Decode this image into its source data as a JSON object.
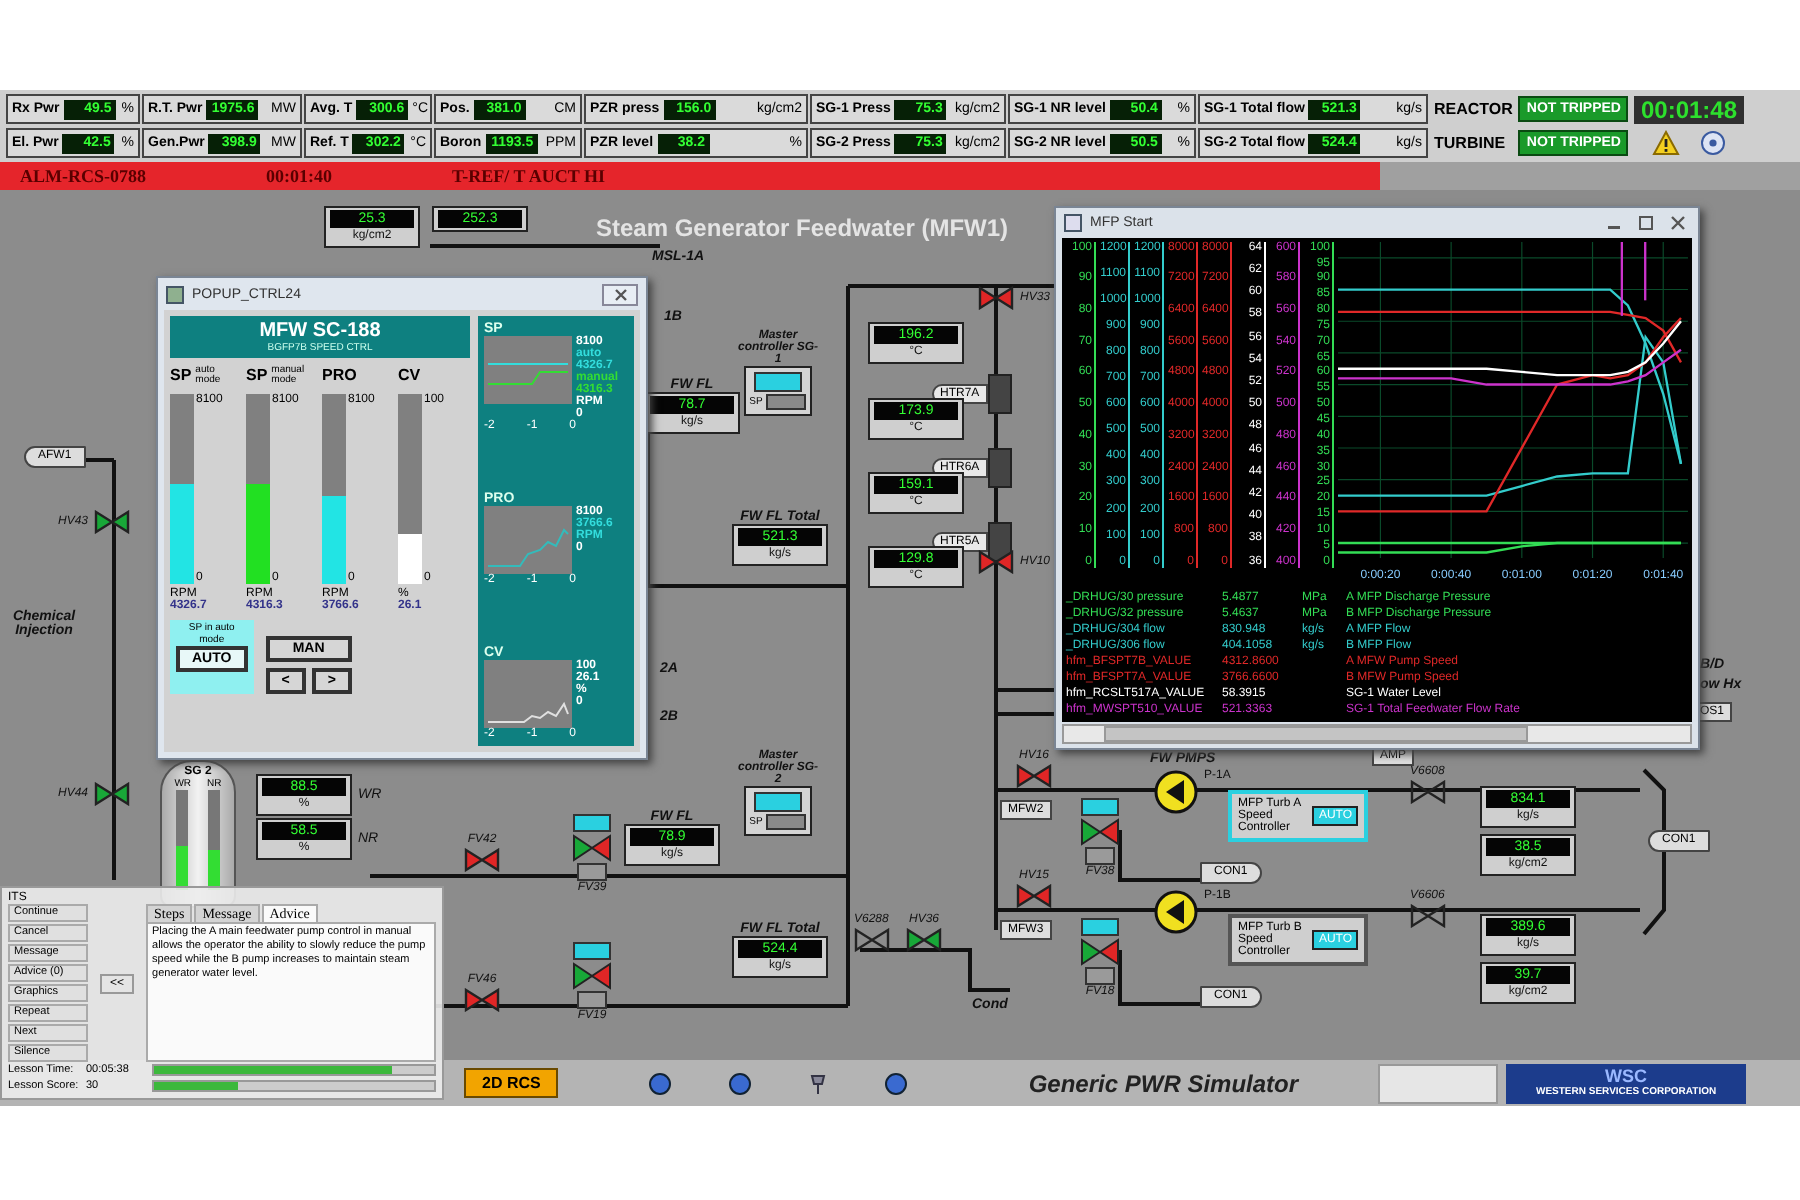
{
  "header": {
    "rows": [
      [
        {
          "label": "Rx Pwr",
          "value": "49.5",
          "unit": "%"
        },
        {
          "label": "R.T. Pwr",
          "value": "1975.6",
          "unit": "MW"
        },
        {
          "label": "Avg. T",
          "value": "300.6",
          "unit": "°C"
        },
        {
          "label": "Pos.",
          "value": "381.0",
          "unit": "CM"
        },
        {
          "label": "PZR press",
          "value": "156.0",
          "unit": "kg/cm2"
        },
        {
          "label": "SG-1 Press",
          "value": "75.3",
          "unit": "kg/cm2"
        },
        {
          "label": "SG-1 NR level",
          "value": "50.4",
          "unit": "%"
        },
        {
          "label": "SG-1 Total flow",
          "value": "521.3",
          "unit": "kg/s"
        }
      ],
      [
        {
          "label": "El. Pwr",
          "value": "42.5",
          "unit": "%"
        },
        {
          "label": "Gen.Pwr",
          "value": "398.9",
          "unit": "MW"
        },
        {
          "label": "Ref. T",
          "value": "302.2",
          "unit": "°C"
        },
        {
          "label": "Boron",
          "value": "1193.5",
          "unit": "PPM"
        },
        {
          "label": "PZR level",
          "value": "38.2",
          "unit": "%"
        },
        {
          "label": "SG-2 Press",
          "value": "75.3",
          "unit": "kg/cm2"
        },
        {
          "label": "SG-2 NR level",
          "value": "50.5",
          "unit": "%"
        },
        {
          "label": "SG-2 Total flow",
          "value": "524.4",
          "unit": "kg/s"
        }
      ]
    ],
    "status": [
      {
        "label": "REACTOR",
        "value": "NOT TRIPPED"
      },
      {
        "label": "TURBINE",
        "value": "NOT TRIPPED"
      }
    ],
    "clock": "00:01:48"
  },
  "alarm": {
    "code": "ALM-RCS-0788",
    "time": "00:01:40",
    "message": "T-REF/ T AUCT HI"
  },
  "diagram": {
    "items": [
      {
        "kind": "readout",
        "value": "25.3",
        "unit": "kg/cm2"
      },
      {
        "kind": "readout",
        "value": "252.3"
      },
      {
        "kind": "title",
        "text": "Steam Generator Feedwater (MFW1)"
      },
      {
        "kind": "label",
        "text": "MSL-1A"
      },
      {
        "kind": "label",
        "text": "1B"
      },
      {
        "kind": "label",
        "text": "2A"
      },
      {
        "kind": "label",
        "text": "2B"
      },
      {
        "kind": "arrow_tag",
        "label": "AFW1",
        "pointing_left": true
      },
      {
        "kind": "valve",
        "label": "HV43",
        "open": true
      },
      {
        "kind": "label",
        "text": "Chemical Injection"
      },
      {
        "kind": "valve",
        "label": "HV44",
        "open": true
      },
      {
        "kind": "tank",
        "label": "SG 2",
        "bars": [
          {
            "label": "WR",
            "level": 0.45
          },
          {
            "label": "NR",
            "level": 0.4
          }
        ]
      },
      {
        "kind": "readout",
        "value": "88.5",
        "unit": "%",
        "note": "WR"
      },
      {
        "kind": "readout",
        "value": "58.5",
        "unit": "%",
        "note": "NR"
      },
      {
        "kind": "readout",
        "title": "FW FL",
        "value": "78.7",
        "unit": "kg/s"
      },
      {
        "kind": "controller",
        "title": "Master controller SG-1",
        "sp_label": "SP"
      },
      {
        "kind": "readout",
        "title": "FW FL Total",
        "value": "521.3",
        "unit": "kg/s"
      },
      {
        "kind": "readout",
        "value": "196.2",
        "unit": "°C"
      },
      {
        "kind": "heater",
        "label": "HTR7A"
      },
      {
        "kind": "readout",
        "value": "173.9",
        "unit": "°C"
      },
      {
        "kind": "heater",
        "label": "HTR6A"
      },
      {
        "kind": "readout",
        "value": "159.1",
        "unit": "°C"
      },
      {
        "kind": "heater",
        "label": "HTR5A"
      },
      {
        "kind": "readout",
        "value": "129.8",
        "unit": "°C"
      },
      {
        "kind": "valve",
        "label": "HV33",
        "open": false
      },
      {
        "kind": "valve",
        "label": "HV10",
        "open": false
      },
      {
        "kind": "controller",
        "title": "Master controller SG-2",
        "sp_label": "SP"
      },
      {
        "kind": "readout",
        "title": "FW FL",
        "value": "78.9",
        "unit": "kg/s"
      },
      {
        "kind": "readout",
        "title": "FW FL Total",
        "value": "524.4",
        "unit": "kg/s"
      },
      {
        "kind": "valve",
        "label": "FV42",
        "open": false
      },
      {
        "kind": "valve",
        "label": "FV46",
        "open": false
      },
      {
        "kind": "control_valve",
        "label": "FV39"
      },
      {
        "kind": "control_valve",
        "label": "FV19"
      },
      {
        "kind": "hand_valve",
        "label": "V6288"
      },
      {
        "kind": "valve",
        "label": "HV36",
        "open": true
      },
      {
        "kind": "label",
        "text": "Cond"
      },
      {
        "kind": "valve",
        "label": "HV16",
        "open": false
      },
      {
        "kind": "tag",
        "label": "MFW2"
      },
      {
        "kind": "valve",
        "label": "HV15",
        "open": false
      },
      {
        "kind": "tag",
        "label": "MFW3"
      },
      {
        "kind": "control_valve",
        "label": "FV38"
      },
      {
        "kind": "control_valve",
        "label": "FV18"
      },
      {
        "kind": "label",
        "text": "FW PMPS"
      },
      {
        "kind": "pump",
        "label": "P-1A"
      },
      {
        "kind": "pump",
        "label": "P-1B"
      },
      {
        "kind": "speed_controller",
        "text": "MFP Turb A Speed Controller",
        "button": "AUTO",
        "highlighted": true
      },
      {
        "kind": "speed_controller",
        "text": "MFP Turb B Speed Controller",
        "button": "AUTO",
        "highlighted": false
      },
      {
        "kind": "arrow_tag",
        "label": "CON1",
        "pointing_left": false
      },
      {
        "kind": "arrow_tag",
        "label": "CON1",
        "pointing_left": false
      },
      {
        "kind": "tag",
        "label": "AMP"
      },
      {
        "kind": "hand_valve",
        "label": "V6608"
      },
      {
        "kind": "hand_valve",
        "label": "V6606"
      },
      {
        "kind": "readout",
        "value": "834.1",
        "unit": "kg/s"
      },
      {
        "kind": "readout",
        "value": "38.5",
        "unit": "kg/cm2"
      },
      {
        "kind": "readout",
        "value": "389.6",
        "unit": "kg/s"
      },
      {
        "kind": "readout",
        "value": "39.7",
        "unit": "kg/cm2"
      },
      {
        "kind": "arrow_tag",
        "label": "CON1",
        "pointing_left": true
      },
      {
        "kind": "label",
        "text": "B/D"
      },
      {
        "kind": "label",
        "text": "ow Hx"
      },
      {
        "kind": "tag",
        "label": "OS1"
      }
    ]
  },
  "popup": {
    "title": "POPUP_CTRL24",
    "heading": "MFW SC-188",
    "subheading": "BGFP7B SPEED CTRL",
    "gauges": [
      {
        "label": "SP",
        "mode": "auto mode",
        "max": "8100",
        "min": "0",
        "unit": "RPM",
        "reading": "4326.7",
        "level": 0.53,
        "color": "#22e4e4"
      },
      {
        "label": "SP",
        "mode": "manual mode",
        "max": "8100",
        "min": "0",
        "unit": "RPM",
        "reading": "4316.3",
        "level": 0.53,
        "color": "#22e022"
      },
      {
        "label": "PRO",
        "max": "8100",
        "min": "0",
        "unit": "RPM",
        "reading": "3766.6",
        "level": 0.46,
        "color": "#22e4e4"
      },
      {
        "label": "CV",
        "max": "100",
        "min": "0",
        "unit": "%",
        "reading": "26.1",
        "level": 0.26,
        "color": "#ffffff"
      }
    ],
    "mode_note": "SP in auto mode",
    "buttons": [
      {
        "label": "AUTO",
        "selected": true
      },
      {
        "label": "MAN",
        "selected": false
      }
    ],
    "nudge_buttons": [
      "<",
      ">"
    ],
    "trends": [
      {
        "label": "SP",
        "max": "8100",
        "min": "0",
        "ticks": [
          "-2",
          "-1",
          "0"
        ],
        "notes": [
          {
            "text": "auto",
            "color": "#33dddd"
          },
          {
            "text": "4326.7",
            "color": "#33dddd"
          },
          {
            "text": "manual",
            "color": "#33dd33"
          },
          {
            "text": "4316.3",
            "color": "#33dd33"
          },
          {
            "text": "RPM",
            "color": "#ffffff"
          }
        ]
      },
      {
        "label": "PRO",
        "max": "8100",
        "min": "0",
        "ticks": [
          "-2",
          "-1",
          "0"
        ],
        "notes": [
          {
            "text": "3766.6",
            "color": "#33dddd"
          },
          {
            "text": "RPM",
            "color": "#33dddd"
          }
        ]
      },
      {
        "label": "CV",
        "max": "100",
        "min": "0",
        "ticks": [
          "-2",
          "-1",
          "0"
        ],
        "notes": [
          {
            "text": "26.1",
            "color": "#ffffff"
          },
          {
            "text": "%",
            "color": "#ffffff"
          }
        ]
      }
    ]
  },
  "trend_window": {
    "title": "MFP Start",
    "axes": [
      {
        "color": "#33dd55",
        "ticks": [
          "100",
          "90",
          "80",
          "70",
          "60",
          "50",
          "40",
          "30",
          "20",
          "10",
          "0"
        ]
      },
      {
        "color": "#33cccc",
        "ticks": [
          "1200",
          "1100",
          "1000",
          "900",
          "800",
          "700",
          "600",
          "500",
          "400",
          "300",
          "200",
          "100",
          "0"
        ]
      },
      {
        "color": "#33cccc",
        "ticks": [
          "1200",
          "1100",
          "1000",
          "900",
          "800",
          "700",
          "600",
          "500",
          "400",
          "300",
          "200",
          "100",
          "0"
        ]
      },
      {
        "color": "#e02828",
        "ticks": [
          "8000",
          "7200",
          "6400",
          "5600",
          "4800",
          "4000",
          "3200",
          "2400",
          "1600",
          "800",
          "0"
        ]
      },
      {
        "color": "#e02828",
        "ticks": [
          "8000",
          "7200",
          "6400",
          "5600",
          "4800",
          "4000",
          "3200",
          "2400",
          "1600",
          "800",
          "0"
        ]
      },
      {
        "color": "#ffffff",
        "ticks": [
          "64",
          "62",
          "60",
          "58",
          "56",
          "54",
          "52",
          "50",
          "48",
          "46",
          "44",
          "42",
          "40",
          "38",
          "36"
        ]
      },
      {
        "color": "#cc33cc",
        "ticks": [
          "600",
          "580",
          "560",
          "540",
          "520",
          "500",
          "480",
          "460",
          "440",
          "420",
          "400"
        ]
      }
    ],
    "chart_data": {
      "type": "line",
      "grid": true,
      "x": [
        8,
        20,
        30,
        40,
        50,
        60,
        70,
        80,
        85,
        90,
        95,
        100,
        105
      ],
      "xlim": [
        8,
        107
      ],
      "ylim": [
        0,
        100
      ],
      "xticks": [
        {
          "value": 20,
          "label": "0:00:20"
        },
        {
          "value": 40,
          "label": "0:00:40"
        },
        {
          "value": 60,
          "label": "0:01:00"
        },
        {
          "value": 80,
          "label": "0:01:20"
        },
        {
          "value": 100,
          "label": "0:01:40"
        }
      ],
      "yticks": [
        100,
        95,
        90,
        85,
        80,
        75,
        70,
        65,
        60,
        55,
        50,
        45,
        40,
        35,
        30,
        25,
        20,
        15,
        10,
        5,
        0
      ],
      "series": [
        {
          "color": "#33dd55",
          "values": [
            5,
            5,
            5,
            5,
            5,
            5,
            5,
            5,
            5,
            5,
            5,
            5,
            5
          ]
        },
        {
          "color": "#33dd55",
          "values": [
            2,
            2,
            2,
            2,
            2,
            4,
            5,
            5,
            5,
            5,
            5,
            5,
            5
          ]
        },
        {
          "color": "#33cccc",
          "values": [
            85,
            85,
            85,
            85,
            85,
            85,
            85,
            85,
            85,
            80,
            68,
            52,
            30
          ]
        },
        {
          "color": "#33cccc",
          "values": [
            20,
            20,
            20,
            20,
            20,
            23,
            26,
            27,
            27,
            27,
            70,
            62,
            30
          ]
        },
        {
          "color": "#e02828",
          "values": [
            78,
            78,
            78,
            78,
            78,
            78,
            78,
            78,
            78,
            77,
            76,
            72,
            62
          ]
        },
        {
          "color": "#e02828",
          "values": [
            15,
            15,
            15,
            15,
            15,
            35,
            55,
            58,
            57,
            58,
            62,
            70,
            76
          ]
        },
        {
          "color": "#ffffff",
          "values": [
            60,
            60,
            60,
            60,
            60,
            59,
            58,
            58,
            58,
            59,
            62,
            68,
            75
          ]
        },
        {
          "color": "#cc33cc",
          "values": [
            57,
            57,
            57,
            57,
            55,
            55,
            55,
            55,
            55,
            56,
            58,
            62,
            66
          ]
        }
      ]
    },
    "legend": [
      {
        "tag": "_DRHUG/30 pressure",
        "value": "5.4877",
        "unit": "MPa",
        "description": "A MFP Discharge Pressure",
        "color": "#33dd55"
      },
      {
        "tag": "_DRHUG/32 pressure",
        "value": "5.4637",
        "unit": "MPa",
        "description": "B MFP Discharge Pressure",
        "color": "#33dd55"
      },
      {
        "tag": "_DRHUG/304 flow",
        "value": "830.948",
        "unit": "kg/s",
        "description": "A MFP Flow",
        "color": "#33cccc"
      },
      {
        "tag": "_DRHUG/306 flow",
        "value": "404.1058",
        "unit": "kg/s",
        "description": "B MFP Flow",
        "color": "#33cccc"
      },
      {
        "tag": "hfm_BFSPT7B_VALUE",
        "value": "4312.8600",
        "description": "A MFW Pump Speed",
        "color": "#e02828"
      },
      {
        "tag": "hfm_BFSPT7A_VALUE",
        "value": "3766.6600",
        "description": "B MFW Pump Speed",
        "color": "#e02828"
      },
      {
        "tag": "hfm_RCSLT517A_VALUE",
        "value": "58.3915",
        "description": "SG-1 Water Level",
        "color": "#ffffff"
      },
      {
        "tag": "hfm_MWSPT510_VALUE",
        "value": "521.3363",
        "description": "SG-1 Total Feedwater Flow Rate",
        "color": "#cc33cc"
      }
    ]
  },
  "its_panel": {
    "title": "ITS",
    "buttons": [
      "Continue",
      "Cancel",
      "Message",
      "Advice (0)",
      "Graphics",
      "Repeat",
      "Next",
      "Silence"
    ],
    "back_button": "<<",
    "tabs": [
      {
        "label": "Steps",
        "selected": false
      },
      {
        "label": "Message",
        "selected": false
      },
      {
        "label": "Advice",
        "selected": true
      }
    ],
    "advice": "Placing the A main feedwater pump control in manual allows the operator the ability to slowly reduce the pump speed while the B pump increases to maintain steam generator water level.",
    "lesson": [
      {
        "label": "Lesson Time:",
        "value": "00:05:38",
        "level": 0.85
      },
      {
        "label": "Lesson Score:",
        "value": "30",
        "level": 0.3
      }
    ]
  },
  "footer": {
    "button": "2D RCS",
    "title": "Generic PWR Simulator",
    "logo_mark": "WSC",
    "logo_text": "WESTERN SERVICES CORPORATION"
  }
}
